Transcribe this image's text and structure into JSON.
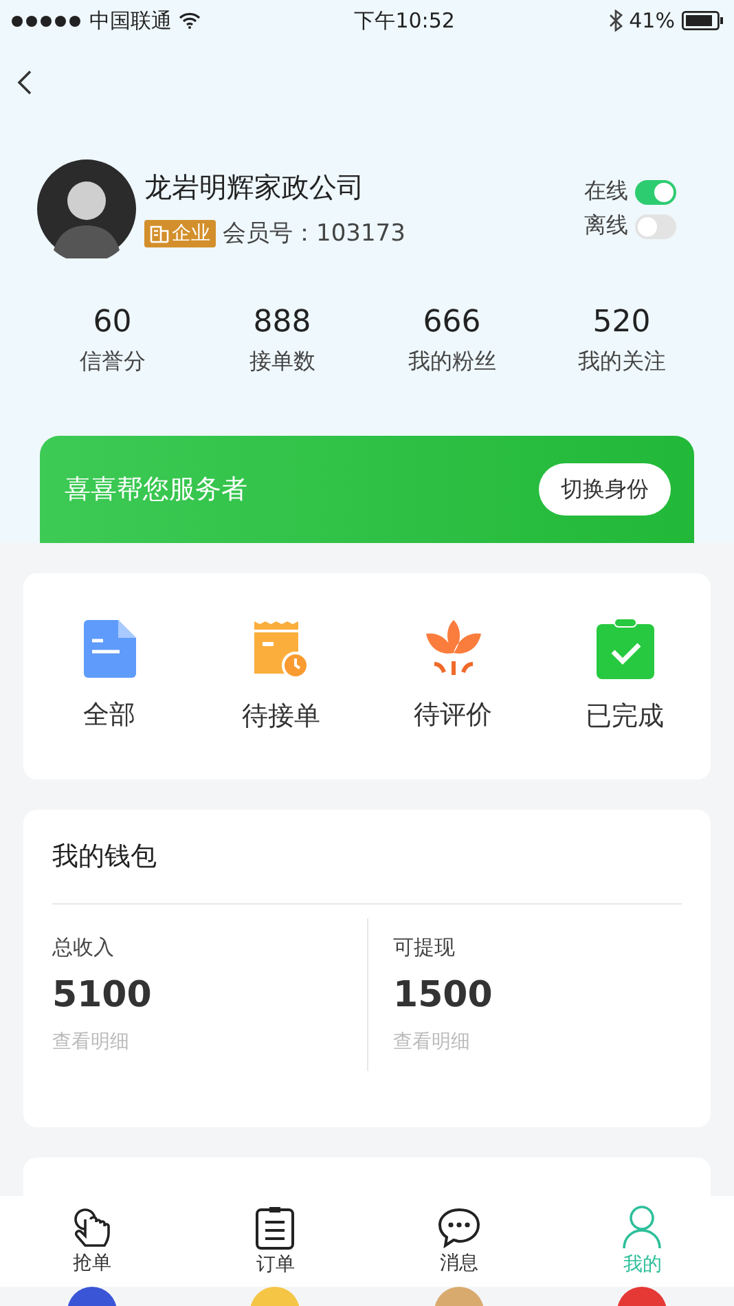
{
  "status_bar": {
    "carrier": "中国联通",
    "time": "下午10:52",
    "battery": "41%"
  },
  "profile": {
    "name": "龙岩明辉家政公司",
    "badge": "企业",
    "member": "会员号：103173",
    "statuses": [
      {
        "label": "在线",
        "on": true
      },
      {
        "label": "离线",
        "on": false
      }
    ]
  },
  "stats": [
    {
      "value": "60",
      "label": "信誉分"
    },
    {
      "value": "888",
      "label": "接单数"
    },
    {
      "value": "666",
      "label": "我的粉丝"
    },
    {
      "value": "520",
      "label": "我的关注"
    }
  ],
  "banner": {
    "text": "喜喜帮您服务者",
    "button": "切换身份"
  },
  "orders": [
    {
      "kind": "doc",
      "label": "全部"
    },
    {
      "kind": "receipt",
      "label": "待接单"
    },
    {
      "kind": "lotus",
      "label": "待评价"
    },
    {
      "kind": "clipboard",
      "label": "已完成"
    }
  ],
  "wallet": {
    "title": "我的钱包",
    "columns": [
      {
        "label": "总收入",
        "amount": "5100",
        "link": "查看明细"
      },
      {
        "label": "可提现",
        "amount": "1500",
        "link": "查看明细"
      }
    ]
  },
  "tab_bar": [
    {
      "kind": "grab",
      "label": "抢单",
      "selected": false
    },
    {
      "kind": "order",
      "label": "订单",
      "selected": false
    },
    {
      "kind": "message",
      "label": "消息",
      "selected": false
    },
    {
      "kind": "me",
      "label": "我的",
      "selected": true
    }
  ]
}
